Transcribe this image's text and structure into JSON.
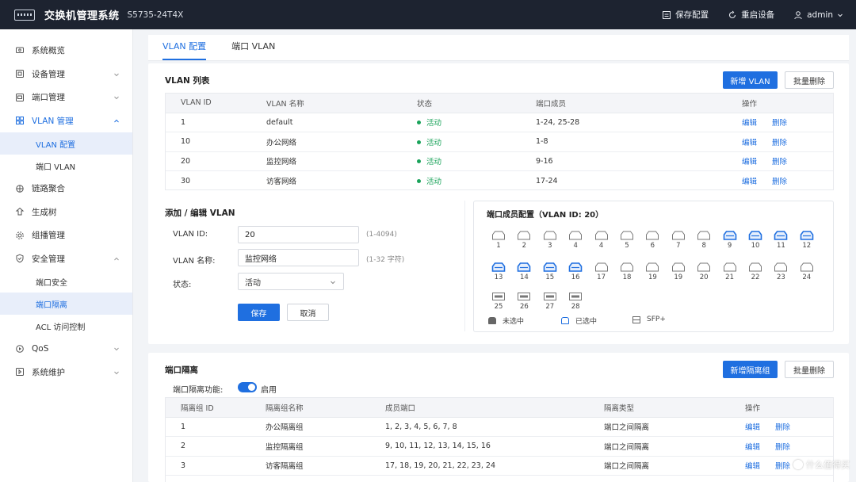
{
  "app": {
    "brand": "交换机管理系统",
    "model": "S5735-24T4X",
    "actions": {
      "save": "保存配置",
      "restart": "重启设备",
      "user": "admin"
    }
  },
  "sidebar": {
    "items": [
      {
        "label": "系统概览"
      },
      {
        "label": "设备管理"
      },
      {
        "label": "端口管理"
      },
      {
        "label": "VLAN 管理"
      },
      {
        "label": "链路聚合"
      },
      {
        "label": "生成树"
      },
      {
        "label": "组播管理"
      },
      {
        "label": "安全管理"
      },
      {
        "label": "QoS"
      },
      {
        "label": "系统维护"
      }
    ],
    "vlan_sub": [
      "VLAN 配置",
      "端口 VLAN"
    ],
    "security_sub": [
      "端口安全",
      "端口隔离",
      "ACL 访问控制"
    ]
  },
  "tabs": [
    "VLAN 配置",
    "端口 VLAN"
  ],
  "vlan_list": {
    "title": "VLAN 列表",
    "add_button": "新增 VLAN",
    "batch_delete": "批量删除",
    "columns": [
      "VLAN ID",
      "VLAN 名称",
      "状态",
      "端口成员",
      "操作"
    ],
    "rows": [
      {
        "id": "1",
        "name": "default",
        "status": "活动",
        "ports": "1-24, 25-28"
      },
      {
        "id": "10",
        "name": "办公网络",
        "status": "活动",
        "ports": "1-8"
      },
      {
        "id": "20",
        "name": "监控网络",
        "status": "活动",
        "ports": "9-16"
      },
      {
        "id": "30",
        "name": "访客网络",
        "status": "活动",
        "ports": "17-24"
      }
    ],
    "edit": "编辑",
    "delete": "删除"
  },
  "form": {
    "title": "添加 / 编辑 VLAN",
    "id_label": "VLAN ID:",
    "id_value": "20",
    "id_hint": "(1-4094)",
    "name_label": "VLAN 名称:",
    "name_value": "监控网络",
    "name_hint": "(1-32 字符)",
    "status_label": "状态:",
    "status_value": "活动",
    "save": "保存",
    "cancel": "取消"
  },
  "ports": {
    "title": "端口成员配置（VLAN ID: 20）",
    "row1": [
      "1",
      "2",
      "3",
      "4",
      "4",
      "5",
      "6",
      "7",
      "8",
      "9",
      "10",
      "11",
      "12"
    ],
    "row1_selected": [
      false,
      false,
      false,
      false,
      false,
      false,
      false,
      false,
      false,
      true,
      true,
      true,
      true
    ],
    "row2": [
      "13",
      "14",
      "15",
      "16",
      "17",
      "18",
      "19",
      "19",
      "20",
      "21",
      "22",
      "23",
      "24"
    ],
    "row2_selected": [
      true,
      true,
      true,
      true,
      false,
      false,
      false,
      false,
      false,
      false,
      false,
      false,
      false
    ],
    "sfp": [
      "25",
      "26",
      "27",
      "28"
    ],
    "legend": {
      "unselected": "未选中",
      "selected": "已选中",
      "sfp": "SFP+"
    }
  },
  "isolation": {
    "title": "端口隔离",
    "add_button": "新增隔离组",
    "batch_delete": "批量删除",
    "toggle_label": "端口隔离功能:",
    "toggle_state": "启用",
    "columns": [
      "隔离组 ID",
      "隔离组名称",
      "成员端口",
      "隔离类型",
      "操作"
    ],
    "rows": [
      {
        "id": "1",
        "name": "办公隔离组",
        "members": "1, 2, 3, 4, 5, 6, 7, 8",
        "type": "端口之间隔离"
      },
      {
        "id": "2",
        "name": "监控隔离组",
        "members": "9, 10, 11, 12, 13, 14, 15, 16",
        "type": "端口之间隔离"
      },
      {
        "id": "3",
        "name": "访客隔离组",
        "members": "17, 18, 19, 20, 21, 22, 23, 24",
        "type": "端口之间隔离"
      }
    ],
    "edit": "编辑",
    "delete": "删除"
  },
  "watermark": "什么值得买",
  "colors": {
    "accent": "#1f6fe0",
    "active": "#1aa35a",
    "topbar": "#1d2330"
  }
}
